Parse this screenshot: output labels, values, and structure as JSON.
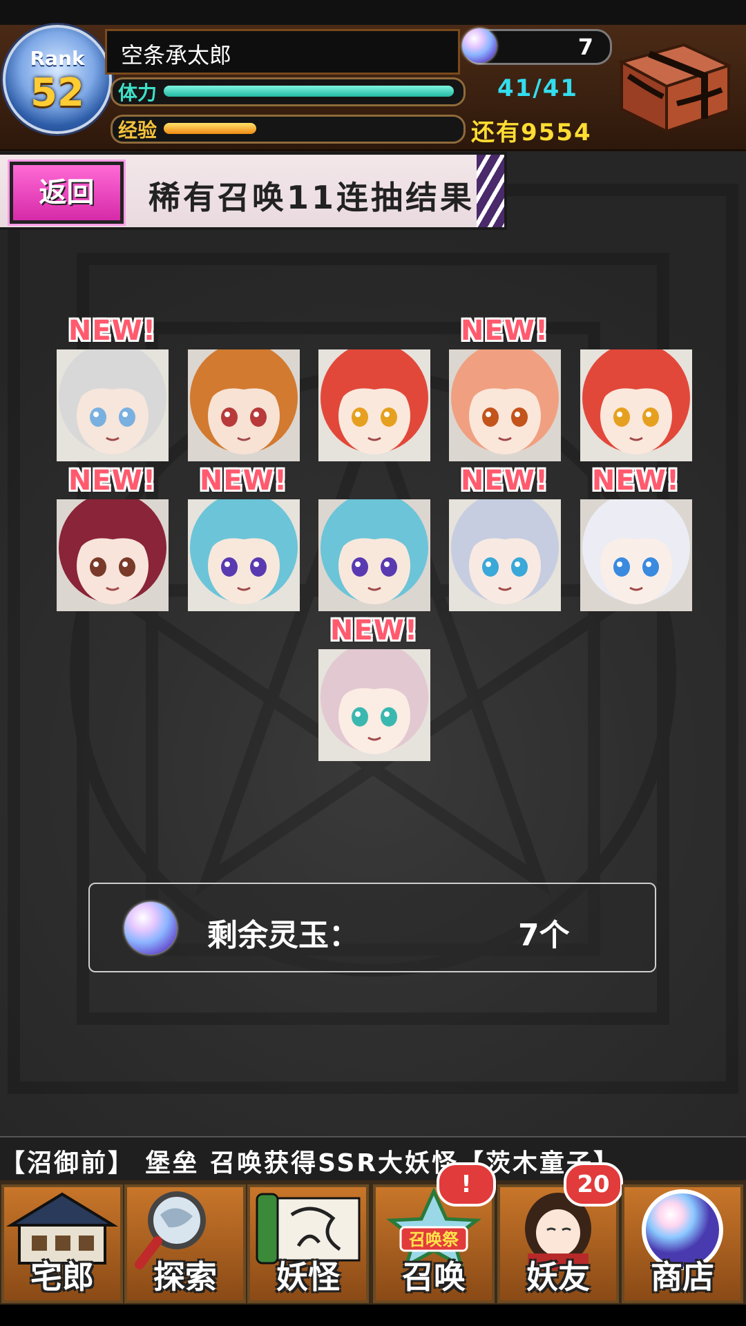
{
  "player": {
    "rank_label": "Rank",
    "rank": "52",
    "name": "空条承太郎",
    "orbs": "7",
    "stamina_label": "体力",
    "stamina": "41/41",
    "stamina_fraction": 1.0,
    "exp_label": "经验",
    "exp_remaining": "还有9554",
    "exp_fraction": 0.32
  },
  "banner": {
    "back_label": "返回",
    "title": "稀有召唤11连抽结果"
  },
  "results": [
    {
      "new": true,
      "hair": "#d8d8d8",
      "eyes": "#7ab0e0",
      "skin": "#f6e6dc"
    },
    {
      "new": false,
      "hair": "#d27a30",
      "eyes": "#b83a3a",
      "skin": "#f7e2d4"
    },
    {
      "new": false,
      "hair": "#e2483a",
      "eyes": "#e6a020",
      "skin": "#fbe8dc"
    },
    {
      "new": true,
      "hair": "#f0a080",
      "eyes": "#c2541c",
      "skin": "#fbe6da"
    },
    {
      "new": false,
      "hair": "#e2483a",
      "eyes": "#e6a020",
      "skin": "#fbe8dc"
    },
    {
      "new": true,
      "hair": "#8a2438",
      "eyes": "#7a3a2a",
      "skin": "#f8e4da"
    },
    {
      "new": true,
      "hair": "#6cc4d8",
      "eyes": "#5a3ab0",
      "skin": "#f8e8dc"
    },
    {
      "new": false,
      "hair": "#6cc4d8",
      "eyes": "#5a3ab0",
      "skin": "#f8e8dc"
    },
    {
      "new": true,
      "hair": "#c6cde0",
      "eyes": "#3aa8d8",
      "skin": "#f8eae2"
    },
    {
      "new": true,
      "hair": "#ececf4",
      "eyes": "#3a8ae0",
      "skin": "#faeee8"
    },
    {
      "new": true,
      "hair": "#e2c8d0",
      "eyes": "#3ab8b0",
      "skin": "#fbece4"
    }
  ],
  "new_tag": "NEW!",
  "remaining": {
    "label": "剩余灵玉：",
    "value": "7个"
  },
  "ticker": "【沼御前】        堡垒 召唤获得SSR大妖怪【茨木童子】",
  "nav": [
    {
      "label": "宅郎",
      "icon": "house-icon"
    },
    {
      "label": "探索",
      "icon": "magnifier-icon"
    },
    {
      "label": "妖怪",
      "icon": "scroll-icon"
    },
    {
      "label": "召唤",
      "icon": "summon-star-icon",
      "badge": "!",
      "sub": "召唤祭"
    },
    {
      "label": "妖友",
      "icon": "friend-icon",
      "badge": "20"
    },
    {
      "label": "商店",
      "icon": "orb-shop-icon"
    }
  ],
  "colors": {
    "stamina": "#3fe0c8",
    "exp": "#f5a623",
    "new_tag": "#ff5a6e",
    "back_button": "#e53cbc"
  }
}
